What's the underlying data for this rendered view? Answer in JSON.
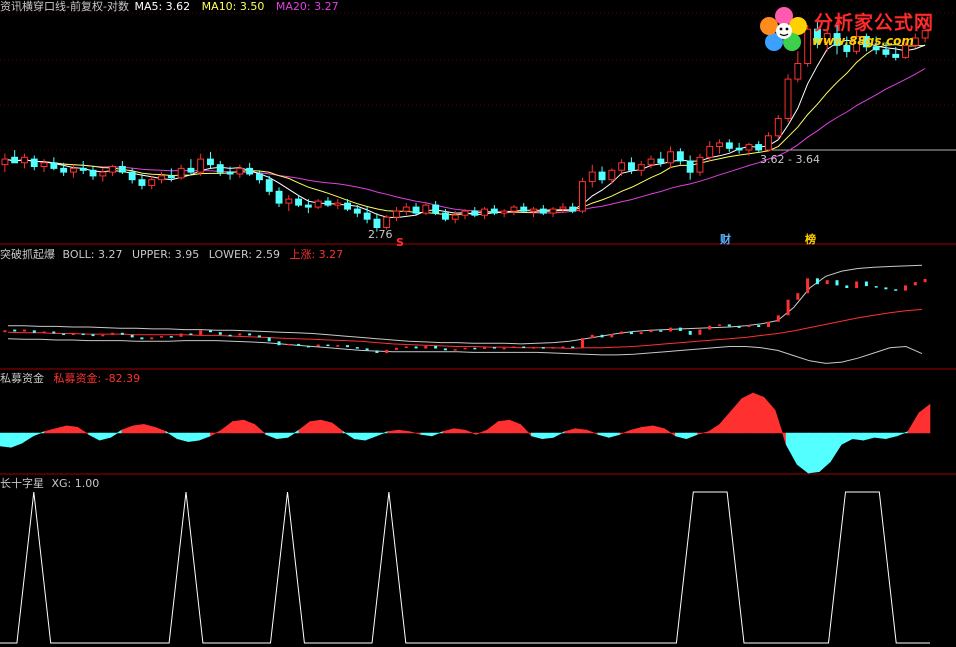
{
  "colors": {
    "bg": "#000000",
    "rise": "#ff3030",
    "fall": "#54ffff",
    "ma5": "#ffffff",
    "ma10": "#ffff5c",
    "ma20": "#e040e0",
    "divider": "#a00000",
    "boll_band": "#c8c8c8",
    "signal": "#ffffff"
  },
  "main": {
    "title": "资讯横穿口线-前复权-对数",
    "ma5_label": "MA5: 3.62",
    "ma10_label": "MA10: 3.50",
    "ma20_label": "MA20: 3.27",
    "high_annotation": "3.62 - 3.64",
    "low_annotation": "2.76",
    "markers": [
      {
        "text": "S",
        "color": "#ff3030"
      },
      {
        "text": "财",
        "color": "#54b4ff"
      },
      {
        "text": "榜",
        "color": "#ffd000"
      }
    ]
  },
  "watermark": {
    "title": "分析家公式网",
    "url": "www.88gs.com"
  },
  "panel_boll": {
    "title": "突破抓起爆",
    "boll_label": "BOLL: 3.27",
    "upper_label": "UPPER: 3.95",
    "lower_label": "LOWER: 2.59",
    "rise_label": "上涨: 3.27"
  },
  "panel_fund": {
    "title": "私募资金",
    "value_label": "私募资金: -82.39"
  },
  "panel_cross": {
    "title": "长十字星",
    "value_label": "XG: 1.00"
  },
  "chart_data": [
    {
      "type": "candlestick",
      "title": "资讯横穿口线-前复权-对数",
      "candles": [
        {
          "o": 2.92,
          "h": 2.98,
          "l": 2.88,
          "c": 2.95
        },
        {
          "o": 2.96,
          "h": 3.0,
          "l": 2.93,
          "c": 2.93
        },
        {
          "o": 2.93,
          "h": 2.98,
          "l": 2.9,
          "c": 2.96
        },
        {
          "o": 2.95,
          "h": 2.97,
          "l": 2.89,
          "c": 2.91
        },
        {
          "o": 2.91,
          "h": 2.95,
          "l": 2.88,
          "c": 2.93
        },
        {
          "o": 2.93,
          "h": 2.96,
          "l": 2.89,
          "c": 2.9
        },
        {
          "o": 2.9,
          "h": 2.93,
          "l": 2.86,
          "c": 2.88
        },
        {
          "o": 2.88,
          "h": 2.92,
          "l": 2.85,
          "c": 2.9
        },
        {
          "o": 2.9,
          "h": 2.94,
          "l": 2.87,
          "c": 2.89
        },
        {
          "o": 2.89,
          "h": 2.91,
          "l": 2.84,
          "c": 2.86
        },
        {
          "o": 2.86,
          "h": 2.9,
          "l": 2.83,
          "c": 2.88
        },
        {
          "o": 2.88,
          "h": 2.92,
          "l": 2.86,
          "c": 2.91
        },
        {
          "o": 2.91,
          "h": 2.94,
          "l": 2.87,
          "c": 2.88
        },
        {
          "o": 2.88,
          "h": 2.9,
          "l": 2.82,
          "c": 2.84
        },
        {
          "o": 2.84,
          "h": 2.87,
          "l": 2.79,
          "c": 2.81
        },
        {
          "o": 2.81,
          "h": 2.86,
          "l": 2.79,
          "c": 2.84
        },
        {
          "o": 2.84,
          "h": 2.88,
          "l": 2.82,
          "c": 2.86
        },
        {
          "o": 2.86,
          "h": 2.9,
          "l": 2.83,
          "c": 2.85
        },
        {
          "o": 2.85,
          "h": 2.92,
          "l": 2.84,
          "c": 2.9
        },
        {
          "o": 2.9,
          "h": 2.95,
          "l": 2.87,
          "c": 2.88
        },
        {
          "o": 2.88,
          "h": 2.98,
          "l": 2.86,
          "c": 2.95
        },
        {
          "o": 2.95,
          "h": 2.99,
          "l": 2.9,
          "c": 2.92
        },
        {
          "o": 2.92,
          "h": 2.94,
          "l": 2.86,
          "c": 2.88
        },
        {
          "o": 2.88,
          "h": 2.91,
          "l": 2.84,
          "c": 2.87
        },
        {
          "o": 2.87,
          "h": 2.92,
          "l": 2.85,
          "c": 2.9
        },
        {
          "o": 2.9,
          "h": 2.93,
          "l": 2.86,
          "c": 2.87
        },
        {
          "o": 2.87,
          "h": 2.89,
          "l": 2.82,
          "c": 2.84
        },
        {
          "o": 2.84,
          "h": 2.86,
          "l": 2.76,
          "c": 2.78
        },
        {
          "o": 2.78,
          "h": 2.8,
          "l": 2.7,
          "c": 2.72
        },
        {
          "o": 2.72,
          "h": 2.76,
          "l": 2.68,
          "c": 2.74
        },
        {
          "o": 2.74,
          "h": 2.76,
          "l": 2.7,
          "c": 2.71
        },
        {
          "o": 2.71,
          "h": 2.74,
          "l": 2.67,
          "c": 2.7
        },
        {
          "o": 2.7,
          "h": 2.74,
          "l": 2.69,
          "c": 2.73
        },
        {
          "o": 2.73,
          "h": 2.75,
          "l": 2.7,
          "c": 2.71
        },
        {
          "o": 2.71,
          "h": 2.74,
          "l": 2.69,
          "c": 2.72
        },
        {
          "o": 2.72,
          "h": 2.74,
          "l": 2.68,
          "c": 2.69
        },
        {
          "o": 2.69,
          "h": 2.71,
          "l": 2.65,
          "c": 2.67
        },
        {
          "o": 2.67,
          "h": 2.7,
          "l": 2.62,
          "c": 2.64
        },
        {
          "o": 2.64,
          "h": 2.67,
          "l": 2.58,
          "c": 2.6
        },
        {
          "o": 2.6,
          "h": 2.66,
          "l": 2.59,
          "c": 2.65
        },
        {
          "o": 2.65,
          "h": 2.7,
          "l": 2.63,
          "c": 2.68
        },
        {
          "o": 2.68,
          "h": 2.72,
          "l": 2.66,
          "c": 2.7
        },
        {
          "o": 2.7,
          "h": 2.72,
          "l": 2.66,
          "c": 2.67
        },
        {
          "o": 2.67,
          "h": 2.72,
          "l": 2.66,
          "c": 2.71
        },
        {
          "o": 2.71,
          "h": 2.73,
          "l": 2.66,
          "c": 2.67
        },
        {
          "o": 2.67,
          "h": 2.69,
          "l": 2.63,
          "c": 2.64
        },
        {
          "o": 2.64,
          "h": 2.68,
          "l": 2.62,
          "c": 2.66
        },
        {
          "o": 2.66,
          "h": 2.69,
          "l": 2.64,
          "c": 2.68
        },
        {
          "o": 2.68,
          "h": 2.7,
          "l": 2.65,
          "c": 2.66
        },
        {
          "o": 2.66,
          "h": 2.7,
          "l": 2.64,
          "c": 2.69
        },
        {
          "o": 2.69,
          "h": 2.71,
          "l": 2.66,
          "c": 2.67
        },
        {
          "o": 2.67,
          "h": 2.69,
          "l": 2.65,
          "c": 2.68
        },
        {
          "o": 2.68,
          "h": 2.71,
          "l": 2.66,
          "c": 2.7
        },
        {
          "o": 2.7,
          "h": 2.72,
          "l": 2.67,
          "c": 2.68
        },
        {
          "o": 2.68,
          "h": 2.7,
          "l": 2.65,
          "c": 2.69
        },
        {
          "o": 2.69,
          "h": 2.71,
          "l": 2.66,
          "c": 2.67
        },
        {
          "o": 2.67,
          "h": 2.7,
          "l": 2.65,
          "c": 2.69
        },
        {
          "o": 2.69,
          "h": 2.72,
          "l": 2.67,
          "c": 2.7
        },
        {
          "o": 2.7,
          "h": 2.72,
          "l": 2.67,
          "c": 2.68
        },
        {
          "o": 2.68,
          "h": 2.85,
          "l": 2.67,
          "c": 2.83
        },
        {
          "o": 2.83,
          "h": 2.92,
          "l": 2.8,
          "c": 2.88
        },
        {
          "o": 2.88,
          "h": 2.91,
          "l": 2.82,
          "c": 2.84
        },
        {
          "o": 2.84,
          "h": 2.9,
          "l": 2.82,
          "c": 2.89
        },
        {
          "o": 2.89,
          "h": 2.95,
          "l": 2.86,
          "c": 2.93
        },
        {
          "o": 2.93,
          "h": 2.96,
          "l": 2.87,
          "c": 2.89
        },
        {
          "o": 2.89,
          "h": 2.94,
          "l": 2.86,
          "c": 2.92
        },
        {
          "o": 2.92,
          "h": 2.97,
          "l": 2.9,
          "c": 2.95
        },
        {
          "o": 2.95,
          "h": 2.99,
          "l": 2.91,
          "c": 2.93
        },
        {
          "o": 2.93,
          "h": 3.02,
          "l": 2.9,
          "c": 2.99
        },
        {
          "o": 2.99,
          "h": 3.01,
          "l": 2.92,
          "c": 2.94
        },
        {
          "o": 2.94,
          "h": 2.97,
          "l": 2.84,
          "c": 2.88
        },
        {
          "o": 2.88,
          "h": 2.98,
          "l": 2.86,
          "c": 2.96
        },
        {
          "o": 2.96,
          "h": 3.05,
          "l": 2.94,
          "c": 3.02
        },
        {
          "o": 3.02,
          "h": 3.06,
          "l": 2.98,
          "c": 3.04
        },
        {
          "o": 3.04,
          "h": 3.06,
          "l": 2.99,
          "c": 3.01
        },
        {
          "o": 3.01,
          "h": 3.04,
          "l": 2.98,
          "c": 3.0
        },
        {
          "o": 3.0,
          "h": 3.04,
          "l": 2.97,
          "c": 3.03
        },
        {
          "o": 3.03,
          "h": 3.05,
          "l": 2.99,
          "c": 3.0
        },
        {
          "o": 3.0,
          "h": 3.1,
          "l": 2.99,
          "c": 3.08
        },
        {
          "o": 3.08,
          "h": 3.2,
          "l": 3.06,
          "c": 3.18
        },
        {
          "o": 3.18,
          "h": 3.45,
          "l": 3.16,
          "c": 3.42
        },
        {
          "o": 3.42,
          "h": 3.6,
          "l": 3.4,
          "c": 3.52
        },
        {
          "o": 3.52,
          "h": 3.78,
          "l": 3.5,
          "c": 3.75
        },
        {
          "o": 3.75,
          "h": 3.8,
          "l": 3.62,
          "c": 3.66
        },
        {
          "o": 3.66,
          "h": 3.76,
          "l": 3.6,
          "c": 3.72
        },
        {
          "o": 3.72,
          "h": 3.78,
          "l": 3.58,
          "c": 3.64
        },
        {
          "o": 3.64,
          "h": 3.7,
          "l": 3.56,
          "c": 3.6
        },
        {
          "o": 3.6,
          "h": 3.74,
          "l": 3.58,
          "c": 3.7
        },
        {
          "o": 3.7,
          "h": 3.72,
          "l": 3.6,
          "c": 3.63
        },
        {
          "o": 3.63,
          "h": 3.7,
          "l": 3.58,
          "c": 3.61
        },
        {
          "o": 3.61,
          "h": 3.66,
          "l": 3.56,
          "c": 3.58
        },
        {
          "o": 3.58,
          "h": 3.63,
          "l": 3.54,
          "c": 3.56
        },
        {
          "o": 3.56,
          "h": 3.66,
          "l": 3.55,
          "c": 3.64
        },
        {
          "o": 3.64,
          "h": 3.72,
          "l": 3.62,
          "c": 3.69
        },
        {
          "o": 3.69,
          "h": 3.77,
          "l": 3.66,
          "c": 3.74
        }
      ],
      "ma5_label": "MA5: 3.62",
      "ma10_label": "MA10: 3.50",
      "ma20_label": "MA20: 3.27",
      "ylim": [
        2.55,
        3.85
      ]
    },
    {
      "type": "line",
      "title": "突破抓起爆",
      "series": [
        {
          "name": "BOLL",
          "values": [
            2.92,
            2.91,
            2.91,
            2.9,
            2.9,
            2.89,
            2.89,
            2.89,
            2.88,
            2.88,
            2.88,
            2.88,
            2.87,
            2.87,
            2.86,
            2.85,
            2.84,
            2.83,
            2.82,
            2.81,
            2.8,
            2.79,
            2.78,
            2.76,
            2.74,
            2.73,
            2.72,
            2.71,
            2.7,
            2.7,
            2.69,
            2.69,
            2.68,
            2.68,
            2.68,
            2.67,
            2.68,
            2.68,
            2.69,
            2.7,
            2.72,
            2.74,
            2.76,
            2.78,
            2.8,
            2.82,
            2.84,
            2.87,
            2.9,
            2.94,
            2.99,
            3.04,
            3.09,
            3.14,
            3.18,
            3.22,
            3.25,
            3.27
          ]
        },
        {
          "name": "UPPER",
          "values": [
            3.02,
            3.02,
            3.01,
            3.01,
            3.0,
            3.0,
            2.99,
            2.98,
            2.98,
            2.97,
            2.97,
            2.96,
            2.96,
            2.95,
            2.95,
            2.94,
            2.93,
            2.92,
            2.91,
            2.9,
            2.88,
            2.86,
            2.84,
            2.82,
            2.8,
            2.78,
            2.77,
            2.76,
            2.76,
            2.75,
            2.75,
            2.75,
            2.74,
            2.75,
            2.76,
            2.78,
            2.82,
            2.86,
            2.9,
            2.93,
            2.95,
            2.96,
            2.97,
            2.98,
            2.99,
            3.0,
            3.02,
            3.05,
            3.1,
            3.3,
            3.6,
            3.78,
            3.86,
            3.9,
            3.92,
            3.93,
            3.94,
            3.95
          ]
        },
        {
          "name": "LOWER",
          "values": [
            2.82,
            2.81,
            2.81,
            2.8,
            2.8,
            2.79,
            2.79,
            2.79,
            2.78,
            2.78,
            2.78,
            2.79,
            2.79,
            2.79,
            2.78,
            2.77,
            2.76,
            2.74,
            2.72,
            2.7,
            2.68,
            2.66,
            2.64,
            2.63,
            2.62,
            2.62,
            2.62,
            2.62,
            2.62,
            2.61,
            2.61,
            2.61,
            2.61,
            2.61,
            2.6,
            2.59,
            2.58,
            2.57,
            2.57,
            2.58,
            2.6,
            2.62,
            2.64,
            2.66,
            2.68,
            2.7,
            2.7,
            2.68,
            2.64,
            2.56,
            2.48,
            2.44,
            2.46,
            2.52,
            2.6,
            2.68,
            2.7,
            2.59
          ]
        }
      ],
      "boll_label": "BOLL: 3.27",
      "upper_label": "UPPER: 3.95",
      "lower_label": "LOWER: 2.59",
      "rise_label": "上涨: 3.27"
    },
    {
      "type": "area",
      "title": "私募资金",
      "values": [
        -45,
        -50,
        -35,
        -10,
        5,
        15,
        25,
        20,
        -5,
        -25,
        -15,
        10,
        25,
        30,
        20,
        5,
        -20,
        -30,
        -25,
        -10,
        10,
        40,
        45,
        30,
        -5,
        -20,
        -15,
        10,
        40,
        45,
        35,
        5,
        -20,
        -25,
        -10,
        5,
        10,
        5,
        -5,
        -10,
        5,
        15,
        10,
        -5,
        10,
        40,
        45,
        30,
        -10,
        -20,
        -15,
        5,
        15,
        10,
        -5,
        -15,
        -5,
        10,
        20,
        25,
        15,
        -10,
        -20,
        -5,
        5,
        30,
        75,
        120,
        140,
        125,
        80,
        -40,
        -110,
        -140,
        -135,
        -100,
        -40,
        -20,
        -25,
        -15,
        -20,
        -10,
        5,
        70,
        100
      ],
      "value_label": "私募资金: -82.39"
    },
    {
      "type": "line",
      "title": "长十字星",
      "values": [
        0,
        0,
        1,
        0,
        0,
        0,
        0,
        0,
        0,
        0,
        0,
        1,
        0,
        0,
        0,
        0,
        0,
        1,
        0,
        0,
        0,
        0,
        0,
        1,
        0,
        0,
        0,
        0,
        0,
        0,
        0,
        0,
        0,
        0,
        0,
        0,
        0,
        0,
        0,
        0,
        0,
        1,
        1,
        1,
        0,
        0,
        0,
        0,
        0,
        0,
        1,
        1,
        1,
        0,
        0,
        0
      ],
      "value_label": "XG: 1.00",
      "ylim": [
        0,
        1
      ]
    }
  ]
}
